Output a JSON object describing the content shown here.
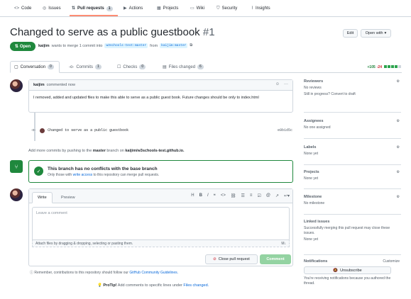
{
  "repo_nav": {
    "code": "Code",
    "issues": "Issues",
    "pull_requests": "Pull requests",
    "pull_requests_count": "1",
    "actions": "Actions",
    "projects": "Projects",
    "wiki": "Wiki",
    "security": "Security",
    "insights": "Insights"
  },
  "pr": {
    "title": "Changed to serve as a public guestbook",
    "number": "#1",
    "edit_label": "Edit",
    "open_with_label": "Open with",
    "state": "Open",
    "author": "kaijim",
    "meta_text": "wants to merge 1 commit into",
    "base_branch": "w3schools-test:master",
    "from_text": "from",
    "head_branch": "kaijim:master"
  },
  "tabs": [
    {
      "label": "Conversation",
      "count": "0"
    },
    {
      "label": "Commits",
      "count": "1"
    },
    {
      "label": "Checks",
      "count": "0"
    },
    {
      "label": "Files changed",
      "count": "6"
    }
  ],
  "diffstat": {
    "additions": "+105",
    "deletions": "-24"
  },
  "comment": {
    "author": "kaijim",
    "time": "commented now",
    "body": "I removed, added and updated files to make this able to serve as a public guest book. Future changes should be only to index.html"
  },
  "commit": {
    "message": "Changed to serve as a public guestbook",
    "sha": "e0b1d5c"
  },
  "add_more": {
    "prefix": "Add more commits by pushing to the",
    "branch": "master",
    "middle": "branch on",
    "repo": "kaijim/w3schools-test.github.io."
  },
  "merge": {
    "title": "This branch has no conflicts with the base branch",
    "prefix": "Only those with",
    "link": "write access",
    "suffix": "to this repository can merge pull requests."
  },
  "editor": {
    "write_tab": "Write",
    "preview_tab": "Preview",
    "placeholder": "Leave a comment",
    "attach": "Attach files by dragging & dropping, selecting or pasting them.",
    "close_label": "Close pull request",
    "comment_label": "Comment"
  },
  "remember": {
    "prefix": "Remember, contributions to this repository should follow our",
    "link": "GitHub Community Guidelines."
  },
  "protip": {
    "label": "ProTip!",
    "text": "Add comments to specific lines under",
    "link": "Files changed."
  },
  "sidebar": {
    "reviewers": {
      "title": "Reviewers",
      "value": "No reviews",
      "extra": "Still in progress? Convert to draft"
    },
    "assignees": {
      "title": "Assignees",
      "value": "No one assigned"
    },
    "labels": {
      "title": "Labels",
      "value": "None yet"
    },
    "projects": {
      "title": "Projects",
      "value": "None yet"
    },
    "milestone": {
      "title": "Milestone",
      "value": "No milestone"
    },
    "linked_issues": {
      "title": "Linked issues",
      "value": "Successfully merging this pull request may close these issues.",
      "extra": "None yet"
    },
    "notifications": {
      "title": "Notifications",
      "customize": "Customize",
      "unsubscribe": "Unsubscribe",
      "reason": "You're receiving notifications because you authored the thread."
    }
  },
  "colors": {
    "accent_green": "#1f883d",
    "link_blue": "#0969da",
    "danger_red": "#cf222e",
    "tab_underline": "#fd8c73"
  }
}
